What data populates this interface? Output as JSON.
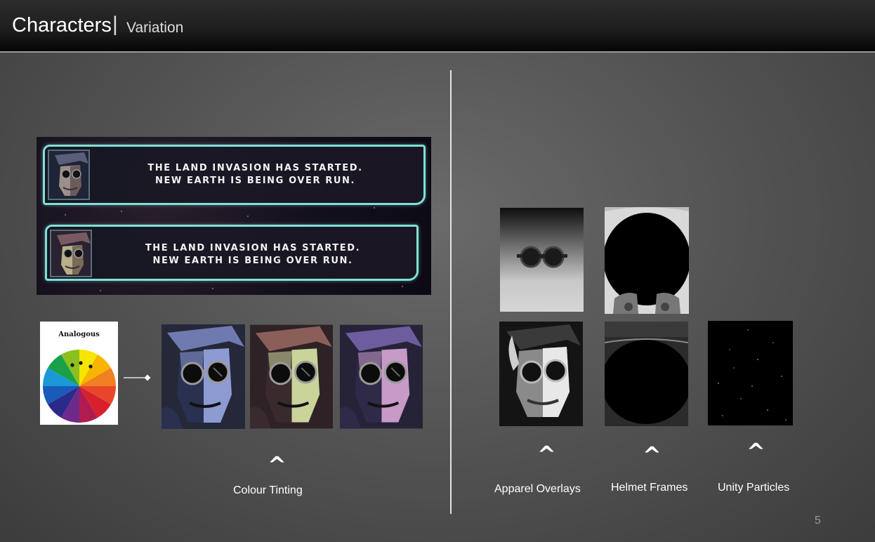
{
  "header": {
    "title": "Characters",
    "separator": "|",
    "subtitle": "Variation"
  },
  "dialogue_banners": [
    {
      "line1": "THE LAND INVASION HAS STARTED.",
      "line2": "NEW EARTH IS BEING OVER RUN."
    },
    {
      "line1": "THE LAND INVASION HAS STARTED.",
      "line2": "NEW EARTH IS BEING OVER RUN."
    }
  ],
  "colour_wheel": {
    "label": "Analogous"
  },
  "tint_variants": [
    {
      "name": "blue",
      "hair": "#6f7bb0",
      "face": "#8d9bd2",
      "shadow": "#2a3050",
      "bg": "#242838"
    },
    {
      "name": "olive-rose",
      "hair": "#8a5f5a",
      "face": "#c9d39a",
      "shadow": "#3a2a2e",
      "bg": "#2e2226"
    },
    {
      "name": "violet-pink",
      "hair": "#6d5c9e",
      "face": "#c89ac8",
      "shadow": "#2e2a48",
      "bg": "#262338"
    }
  ],
  "captions": {
    "caret": "^",
    "colour_tinting": "Colour Tinting",
    "apparel_overlays": "Apparel Overlays",
    "helmet_frames": "Helmet Frames",
    "unity_particles": "Unity Particles"
  },
  "accent_color": "#7fe0d6",
  "page_number": "5"
}
